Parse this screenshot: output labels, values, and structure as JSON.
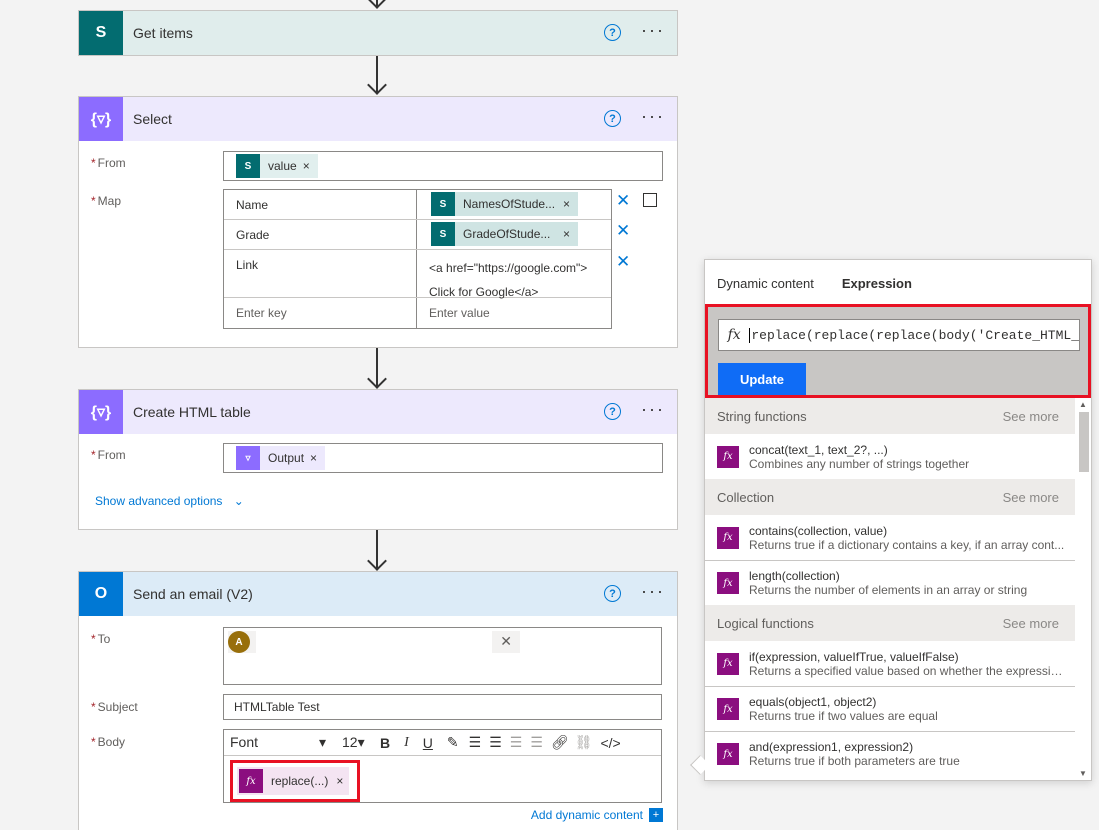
{
  "flow": {
    "get_items": {
      "title": "Get items"
    },
    "select": {
      "title": "Select",
      "from_label": "From",
      "from_token": "value",
      "map_label": "Map",
      "rows": [
        {
          "key": "Name",
          "value_token": "NamesOfStude..."
        },
        {
          "key": "Grade",
          "value_token": "GradeOfStude..."
        },
        {
          "key": "Link",
          "value_line1": "<a href=\"https://google.com\">",
          "value_line2": "Click for Google</a>"
        }
      ],
      "key_placeholder": "Enter key",
      "value_placeholder": "Enter value"
    },
    "create_html": {
      "title": "Create HTML table",
      "from_label": "From",
      "from_token": "Output",
      "advanced": "Show advanced options"
    },
    "send_email": {
      "title": "Send an email (V2)",
      "to_label": "To",
      "to_avatar": "A",
      "subject_label": "Subject",
      "subject_value": "HTMLTable Test",
      "body_label": "Body",
      "font_value": "Font",
      "font_size": "12",
      "body_token": "replace(...)",
      "add_dynamic": "Add dynamic content"
    }
  },
  "panel": {
    "tab_dynamic": "Dynamic content",
    "tab_expression": "Expression",
    "expression_value": "replace(replace(replace(body('Create_HTML_",
    "update_label": "Update",
    "sections": [
      {
        "title": "String functions",
        "see_more": "See more",
        "items": [
          {
            "name": "concat(text_1, text_2?, ...)",
            "desc": "Combines any number of strings together"
          }
        ]
      },
      {
        "title": "Collection",
        "see_more": "See more",
        "items": [
          {
            "name": "contains(collection, value)",
            "desc": "Returns true if a dictionary contains a key, if an array cont..."
          },
          {
            "name": "length(collection)",
            "desc": "Returns the number of elements in an array or string"
          }
        ]
      },
      {
        "title": "Logical functions",
        "see_more": "See more",
        "items": [
          {
            "name": "if(expression, valueIfTrue, valueIfFalse)",
            "desc": "Returns a specified value based on whether the expressio..."
          },
          {
            "name": "equals(object1, object2)",
            "desc": "Returns true if two values are equal"
          },
          {
            "name": "and(expression1, expression2)",
            "desc": "Returns true if both parameters are true"
          }
        ]
      }
    ]
  },
  "colors": {
    "sharepoint": "#036c70",
    "select_action": "#8c6cff",
    "outlook": "#0078d4",
    "highlight": "#e81123",
    "fx_purple": "#8b0e7f"
  }
}
